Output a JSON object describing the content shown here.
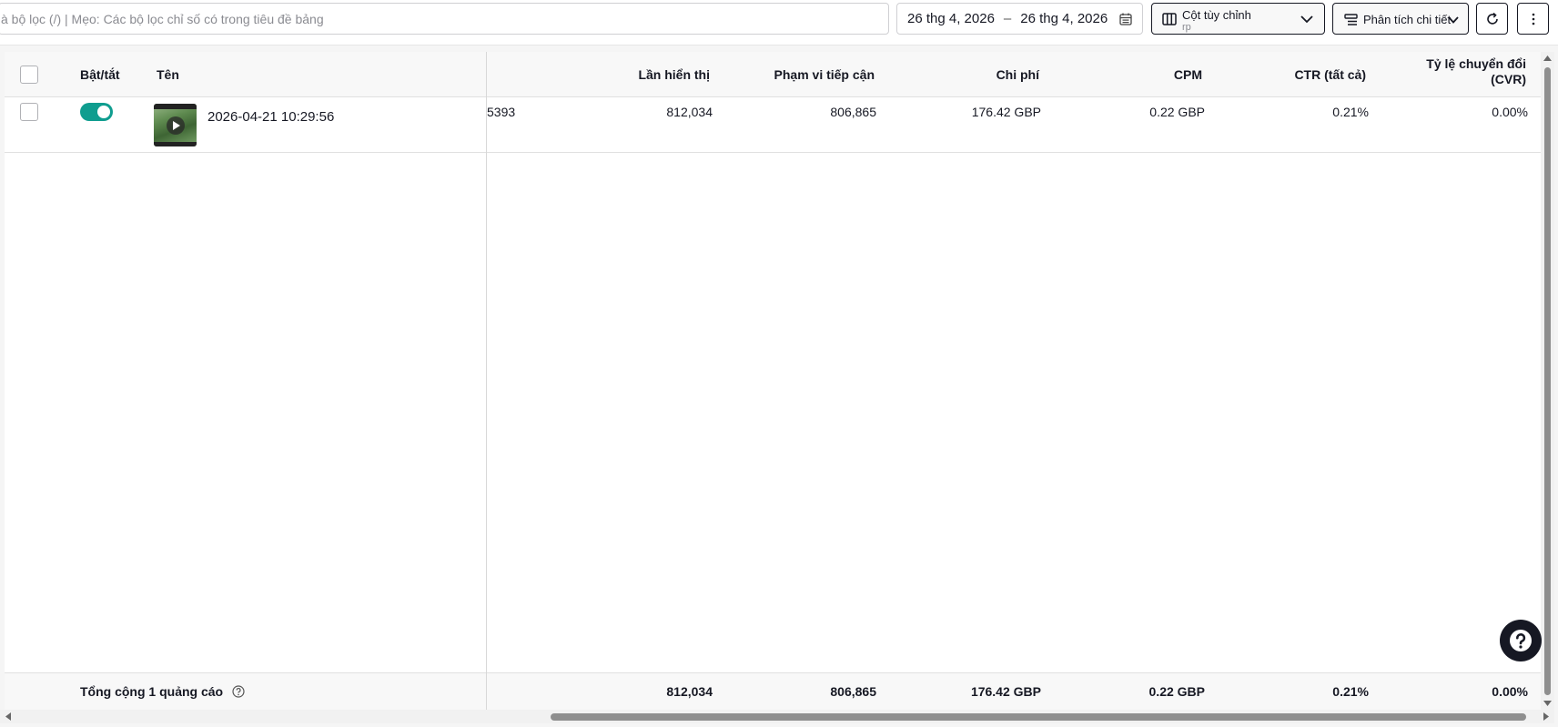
{
  "toolbar": {
    "search_placeholder": "à bộ lọc (/) | Mẹo: Các bộ lọc chỉ số có trong tiêu đề bảng",
    "date_start": "26 thg 4, 2026",
    "date_sep": "–",
    "date_end": "26 thg 4, 2026",
    "columns_label": "Cột tùy chỉnh",
    "columns_sub": "rp",
    "breakdown_label": "Phân tích chi tiết"
  },
  "table": {
    "headers": {
      "toggle": "Bật/tắt",
      "name": "Tên",
      "impressions": "Lần hiển thị",
      "reach": "Phạm vi tiếp cận",
      "cost": "Chi phí",
      "cpm": "CPM",
      "ctr": "CTR (tất cả)",
      "cvr_line1": "Tỷ lệ chuyển đổi",
      "cvr_line2": "(CVR)"
    },
    "rows": [
      {
        "name": "2026-04-21 10:29:56",
        "partial": "5393",
        "impressions": "812,034",
        "reach": "806,865",
        "cost": "176.42 GBP",
        "cpm": "0.22 GBP",
        "ctr": "0.21%",
        "cvr": "0.00%",
        "enabled": true
      }
    ],
    "totals": {
      "label": "Tổng cộng 1 quảng cáo",
      "impressions": "812,034",
      "reach": "806,865",
      "cost": "176.42 GBP",
      "cpm": "0.22 GBP",
      "ctr": "0.21%",
      "cvr": "0.00%"
    }
  },
  "colors": {
    "accent": "#0f9d8f",
    "text": "#161823",
    "muted": "#8a8b91"
  },
  "icons": [
    "calendar-icon",
    "columns-icon",
    "chevron-down-icon",
    "breakdown-icon",
    "refresh-icon",
    "more-vertical-icon",
    "play-icon",
    "help-circle-icon",
    "help-fab-icon"
  ]
}
